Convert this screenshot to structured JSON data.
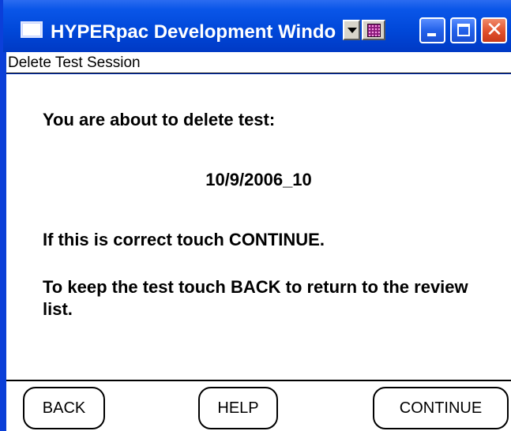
{
  "window": {
    "title": "HYPERpac Development Windo"
  },
  "menubar": {
    "title": "Delete Test Session"
  },
  "message": {
    "intro": "You are about to delete test:",
    "test_id": "10/9/2006_10",
    "confirm": "If this is correct touch CONTINUE.",
    "keep": "To keep the test touch BACK to return to the review list."
  },
  "buttons": {
    "back": "BACK",
    "help": "HELP",
    "continue": "CONTINUE"
  },
  "icons": {
    "app": "window-app-icon",
    "dropdown": "chevron-down-icon",
    "keyboard": "keyboard-icon",
    "minimize": "minimize-icon",
    "maximize": "maximize-icon",
    "close": "close-icon"
  },
  "colors": {
    "titlebar": "#0047d8",
    "close_button": "#e0502c"
  }
}
